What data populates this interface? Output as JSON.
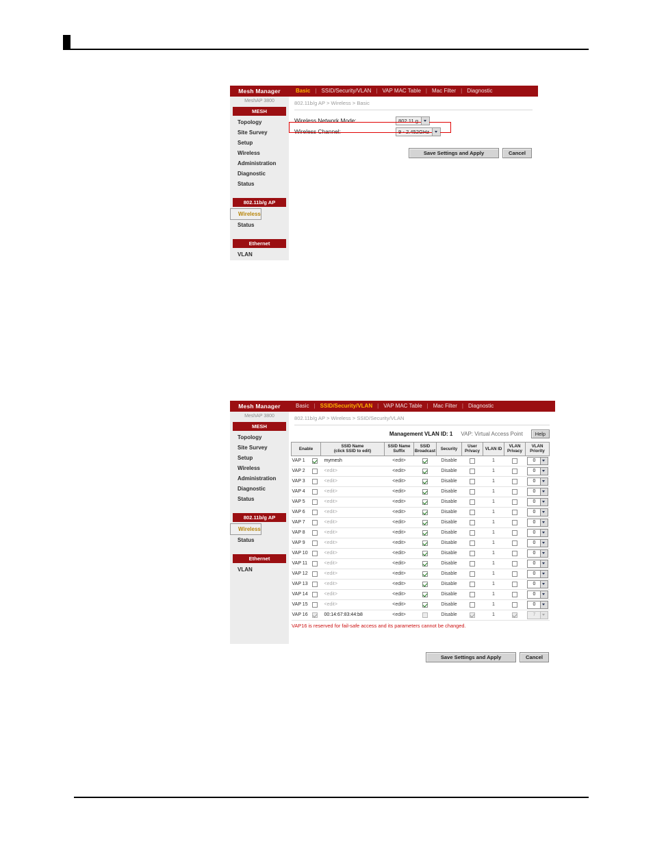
{
  "page": {
    "mark": "black-square-bullet"
  },
  "panel1": {
    "brand": "Mesh Manager",
    "model": "MeshAP 3800",
    "tabs": [
      {
        "label": "Basic",
        "active": true
      },
      {
        "label": "SSID/Security/VLAN",
        "active": false
      },
      {
        "label": "VAP MAC Table",
        "active": false
      },
      {
        "label": "Mac Filter",
        "active": false
      },
      {
        "label": "Diagnostic",
        "active": false
      }
    ],
    "breadcrumb": "802.11b/g AP > Wireless > Basic",
    "sidebar": {
      "groups": [
        {
          "title": "MESH",
          "items": [
            {
              "label": "Topology",
              "selected": false
            },
            {
              "label": "Site Survey",
              "selected": false
            },
            {
              "label": "Setup",
              "selected": false
            },
            {
              "label": "Wireless",
              "selected": false
            },
            {
              "label": "Administration",
              "selected": false
            },
            {
              "label": "Diagnostic",
              "selected": false
            },
            {
              "label": "Status",
              "selected": false
            }
          ]
        },
        {
          "title": "802.11b/g AP",
          "items": [
            {
              "label": "Wireless",
              "selected": true
            },
            {
              "label": "Status",
              "selected": false
            }
          ]
        },
        {
          "title": "Ethernet",
          "items": [
            {
              "label": "VLAN",
              "selected": false
            }
          ]
        }
      ]
    },
    "fields": [
      {
        "label": "Wireless Network Mode:",
        "value": "802.11 g",
        "highlighted": false
      },
      {
        "label": "Wireless Channel:",
        "value": "9 - 2.452GHz",
        "highlighted": true
      }
    ],
    "buttons": {
      "save": "Save Settings and Apply",
      "cancel": "Cancel"
    }
  },
  "panel2": {
    "brand": "Mesh Manager",
    "model": "MeshAP 3800",
    "tabs": [
      {
        "label": "Basic",
        "active": false
      },
      {
        "label": "SSID/Security/VLAN",
        "active": true
      },
      {
        "label": "VAP MAC Table",
        "active": false
      },
      {
        "label": "Mac Filter",
        "active": false
      },
      {
        "label": "Diagnostic",
        "active": false
      }
    ],
    "breadcrumb": "802.11b/g AP > Wireless > SSID/Security/VLAN",
    "sidebar": {
      "groups": [
        {
          "title": "MESH",
          "items": [
            {
              "label": "Topology",
              "selected": false
            },
            {
              "label": "Site Survey",
              "selected": false
            },
            {
              "label": "Setup",
              "selected": false
            },
            {
              "label": "Wireless",
              "selected": false
            },
            {
              "label": "Administration",
              "selected": false
            },
            {
              "label": "Diagnostic",
              "selected": false
            },
            {
              "label": "Status",
              "selected": false
            }
          ]
        },
        {
          "title": "802.11b/g AP",
          "items": [
            {
              "label": "Wireless",
              "selected": true
            },
            {
              "label": "Status",
              "selected": false
            }
          ]
        },
        {
          "title": "Ethernet",
          "items": [
            {
              "label": "VLAN",
              "selected": false
            }
          ]
        }
      ]
    },
    "info": {
      "management_vlan": "Management VLAN ID: 1",
      "vap_note": "VAP: Virtual Access Point",
      "help": "Help"
    },
    "table": {
      "headers": [
        "Enable",
        "SSID Name\n(click SSID to edit)",
        "SSID Name\nSuffix",
        "SSID\nBroadcast",
        "Security",
        "User\nPrivacy",
        "VLAN ID",
        "VLAN\nPrivacy",
        "VLAN\nPriority"
      ],
      "rows": [
        {
          "vap": "VAP 1",
          "enable": true,
          "ssid": "mymesh",
          "ssid_is_edit": false,
          "suffix": "<edit>",
          "broadcast": true,
          "security": "Disable",
          "user_privacy": false,
          "vlan_id": "1",
          "vlan_privacy": false,
          "vlan_priority": "0",
          "locked": false
        },
        {
          "vap": "VAP 2",
          "enable": false,
          "ssid": "<edit>",
          "ssid_is_edit": true,
          "suffix": "<edit>",
          "broadcast": true,
          "security": "Disable",
          "user_privacy": false,
          "vlan_id": "1",
          "vlan_privacy": false,
          "vlan_priority": "0",
          "locked": false
        },
        {
          "vap": "VAP 3",
          "enable": false,
          "ssid": "<edit>",
          "ssid_is_edit": true,
          "suffix": "<edit>",
          "broadcast": true,
          "security": "Disable",
          "user_privacy": false,
          "vlan_id": "1",
          "vlan_privacy": false,
          "vlan_priority": "0",
          "locked": false
        },
        {
          "vap": "VAP 4",
          "enable": false,
          "ssid": "<edit>",
          "ssid_is_edit": true,
          "suffix": "<edit>",
          "broadcast": true,
          "security": "Disable",
          "user_privacy": false,
          "vlan_id": "1",
          "vlan_privacy": false,
          "vlan_priority": "0",
          "locked": false
        },
        {
          "vap": "VAP 5",
          "enable": false,
          "ssid": "<edit>",
          "ssid_is_edit": true,
          "suffix": "<edit>",
          "broadcast": true,
          "security": "Disable",
          "user_privacy": false,
          "vlan_id": "1",
          "vlan_privacy": false,
          "vlan_priority": "0",
          "locked": false
        },
        {
          "vap": "VAP 6",
          "enable": false,
          "ssid": "<edit>",
          "ssid_is_edit": true,
          "suffix": "<edit>",
          "broadcast": true,
          "security": "Disable",
          "user_privacy": false,
          "vlan_id": "1",
          "vlan_privacy": false,
          "vlan_priority": "0",
          "locked": false
        },
        {
          "vap": "VAP 7",
          "enable": false,
          "ssid": "<edit>",
          "ssid_is_edit": true,
          "suffix": "<edit>",
          "broadcast": true,
          "security": "Disable",
          "user_privacy": false,
          "vlan_id": "1",
          "vlan_privacy": false,
          "vlan_priority": "0",
          "locked": false
        },
        {
          "vap": "VAP 8",
          "enable": false,
          "ssid": "<edit>",
          "ssid_is_edit": true,
          "suffix": "<edit>",
          "broadcast": true,
          "security": "Disable",
          "user_privacy": false,
          "vlan_id": "1",
          "vlan_privacy": false,
          "vlan_priority": "0",
          "locked": false
        },
        {
          "vap": "VAP 9",
          "enable": false,
          "ssid": "<edit>",
          "ssid_is_edit": true,
          "suffix": "<edit>",
          "broadcast": true,
          "security": "Disable",
          "user_privacy": false,
          "vlan_id": "1",
          "vlan_privacy": false,
          "vlan_priority": "0",
          "locked": false
        },
        {
          "vap": "VAP 10",
          "enable": false,
          "ssid": "<edit>",
          "ssid_is_edit": true,
          "suffix": "<edit>",
          "broadcast": true,
          "security": "Disable",
          "user_privacy": false,
          "vlan_id": "1",
          "vlan_privacy": false,
          "vlan_priority": "0",
          "locked": false
        },
        {
          "vap": "VAP 11",
          "enable": false,
          "ssid": "<edit>",
          "ssid_is_edit": true,
          "suffix": "<edit>",
          "broadcast": true,
          "security": "Disable",
          "user_privacy": false,
          "vlan_id": "1",
          "vlan_privacy": false,
          "vlan_priority": "0",
          "locked": false
        },
        {
          "vap": "VAP 12",
          "enable": false,
          "ssid": "<edit>",
          "ssid_is_edit": true,
          "suffix": "<edit>",
          "broadcast": true,
          "security": "Disable",
          "user_privacy": false,
          "vlan_id": "1",
          "vlan_privacy": false,
          "vlan_priority": "0",
          "locked": false
        },
        {
          "vap": "VAP 13",
          "enable": false,
          "ssid": "<edit>",
          "ssid_is_edit": true,
          "suffix": "<edit>",
          "broadcast": true,
          "security": "Disable",
          "user_privacy": false,
          "vlan_id": "1",
          "vlan_privacy": false,
          "vlan_priority": "0",
          "locked": false
        },
        {
          "vap": "VAP 14",
          "enable": false,
          "ssid": "<edit>",
          "ssid_is_edit": true,
          "suffix": "<edit>",
          "broadcast": true,
          "security": "Disable",
          "user_privacy": false,
          "vlan_id": "1",
          "vlan_privacy": false,
          "vlan_priority": "0",
          "locked": false
        },
        {
          "vap": "VAP 15",
          "enable": false,
          "ssid": "<edit>",
          "ssid_is_edit": true,
          "suffix": "<edit>",
          "broadcast": true,
          "security": "Disable",
          "user_privacy": false,
          "vlan_id": "1",
          "vlan_privacy": false,
          "vlan_priority": "0",
          "locked": false
        },
        {
          "vap": "VAP 16",
          "enable": true,
          "ssid": "00:14:67:83:44:b8",
          "ssid_is_edit": false,
          "suffix": "<edit>",
          "broadcast": false,
          "security": "Disable",
          "user_privacy": true,
          "vlan_id": "1",
          "vlan_privacy": true,
          "vlan_priority": "7",
          "locked": true
        }
      ]
    },
    "warning": "VAP16 is reserved for fail-safe access and its parameters cannot be changed.",
    "buttons": {
      "save": "Save Settings and Apply",
      "cancel": "Cancel"
    }
  },
  "colors": {
    "brand_red": "#9b0f12",
    "accent_gold": "#ffb400",
    "warn_red": "#cc1111",
    "highlight_red": "#e00000",
    "panel_gray": "#ececec"
  }
}
